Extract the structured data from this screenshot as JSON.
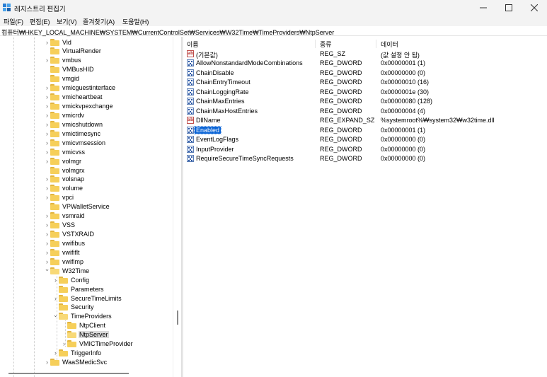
{
  "window": {
    "title": "레지스트리 편집기",
    "controls": {
      "minimize": "minimize-icon",
      "maximize": "maximize-icon",
      "close": "close-icon"
    }
  },
  "menu": [
    "파일(F)",
    "편집(E)",
    "보기(V)",
    "즐겨찾기(A)",
    "도움말(H)"
  ],
  "address": "컴퓨터₩HKEY_LOCAL_MACHINE₩SYSTEM₩CurrentControlSet₩Services₩W32Time₩TimeProviders₩NtpServer",
  "tree": [
    {
      "label": "Vid",
      "level": 0,
      "expandable": true
    },
    {
      "label": "VirtualRender",
      "level": 0,
      "expandable": false
    },
    {
      "label": "vmbus",
      "level": 0,
      "expandable": true
    },
    {
      "label": "VMBusHID",
      "level": 0,
      "expandable": false
    },
    {
      "label": "vmgid",
      "level": 0,
      "expandable": false
    },
    {
      "label": "vmicguestinterface",
      "level": 0,
      "expandable": true
    },
    {
      "label": "vmicheartbeat",
      "level": 0,
      "expandable": true
    },
    {
      "label": "vmickvpexchange",
      "level": 0,
      "expandable": true
    },
    {
      "label": "vmicrdv",
      "level": 0,
      "expandable": true
    },
    {
      "label": "vmicshutdown",
      "level": 0,
      "expandable": true
    },
    {
      "label": "vmictimesync",
      "level": 0,
      "expandable": true
    },
    {
      "label": "vmicvmsession",
      "level": 0,
      "expandable": true
    },
    {
      "label": "vmicvss",
      "level": 0,
      "expandable": true
    },
    {
      "label": "volmgr",
      "level": 0,
      "expandable": true
    },
    {
      "label": "volmgrx",
      "level": 0,
      "expandable": false
    },
    {
      "label": "volsnap",
      "level": 0,
      "expandable": true
    },
    {
      "label": "volume",
      "level": 0,
      "expandable": true
    },
    {
      "label": "vpci",
      "level": 0,
      "expandable": true
    },
    {
      "label": "VPWalletService",
      "level": 0,
      "expandable": false
    },
    {
      "label": "vsmraid",
      "level": 0,
      "expandable": true
    },
    {
      "label": "VSS",
      "level": 0,
      "expandable": true
    },
    {
      "label": "VSTXRAID",
      "level": 0,
      "expandable": true
    },
    {
      "label": "vwifibus",
      "level": 0,
      "expandable": true
    },
    {
      "label": "vwififlt",
      "level": 0,
      "expandable": true
    },
    {
      "label": "vwifimp",
      "level": 0,
      "expandable": true
    },
    {
      "label": "W32Time",
      "level": 0,
      "expandable": true,
      "expanded": true
    },
    {
      "label": "Config",
      "level": 1,
      "expandable": true
    },
    {
      "label": "Parameters",
      "level": 1,
      "expandable": false
    },
    {
      "label": "SecureTimeLimits",
      "level": 1,
      "expandable": true
    },
    {
      "label": "Security",
      "level": 1,
      "expandable": false
    },
    {
      "label": "TimeProviders",
      "level": 1,
      "expandable": true,
      "expanded": true
    },
    {
      "label": "NtpClient",
      "level": 2,
      "expandable": false
    },
    {
      "label": "NtpServer",
      "level": 2,
      "expandable": false,
      "selected": true
    },
    {
      "label": "VMICTimeProvider",
      "level": 2,
      "expandable": true
    },
    {
      "label": "TriggerInfo",
      "level": 1,
      "expandable": true
    },
    {
      "label": "WaaSMedicSvc",
      "level": 0,
      "expandable": true
    }
  ],
  "columns": {
    "name": "이름",
    "type": "종류",
    "data": "데이터"
  },
  "values": [
    {
      "name": "(기본값)",
      "type": "REG_SZ",
      "data": "(값 설정 안 됨)",
      "icon": "string-value-icon"
    },
    {
      "name": "AllowNonstandardModeCombinations",
      "type": "REG_DWORD",
      "data": "0x00000001 (1)",
      "icon": "binary-value-icon"
    },
    {
      "name": "ChainDisable",
      "type": "REG_DWORD",
      "data": "0x00000000 (0)",
      "icon": "binary-value-icon"
    },
    {
      "name": "ChainEntryTimeout",
      "type": "REG_DWORD",
      "data": "0x00000010 (16)",
      "icon": "binary-value-icon"
    },
    {
      "name": "ChainLoggingRate",
      "type": "REG_DWORD",
      "data": "0x0000001e (30)",
      "icon": "binary-value-icon"
    },
    {
      "name": "ChainMaxEntries",
      "type": "REG_DWORD",
      "data": "0x00000080 (128)",
      "icon": "binary-value-icon"
    },
    {
      "name": "ChainMaxHostEntries",
      "type": "REG_DWORD",
      "data": "0x00000004 (4)",
      "icon": "binary-value-icon"
    },
    {
      "name": "DllName",
      "type": "REG_EXPAND_SZ",
      "data": "%systemroot%₩system32₩w32time.dll",
      "icon": "string-value-icon"
    },
    {
      "name": "Enabled",
      "type": "REG_DWORD",
      "data": "0x00000001 (1)",
      "icon": "binary-value-icon",
      "selected": true
    },
    {
      "name": "EventLogFlags",
      "type": "REG_DWORD",
      "data": "0x00000000 (0)",
      "icon": "binary-value-icon"
    },
    {
      "name": "InputProvider",
      "type": "REG_DWORD",
      "data": "0x00000000 (0)",
      "icon": "binary-value-icon"
    },
    {
      "name": "RequireSecureTimeSyncRequests",
      "type": "REG_DWORD",
      "data": "0x00000000 (0)",
      "icon": "binary-value-icon"
    }
  ],
  "colors": {
    "accent": "#0a64d6",
    "folder": "#f6cf5a",
    "chrome": "#f3f3f3"
  }
}
